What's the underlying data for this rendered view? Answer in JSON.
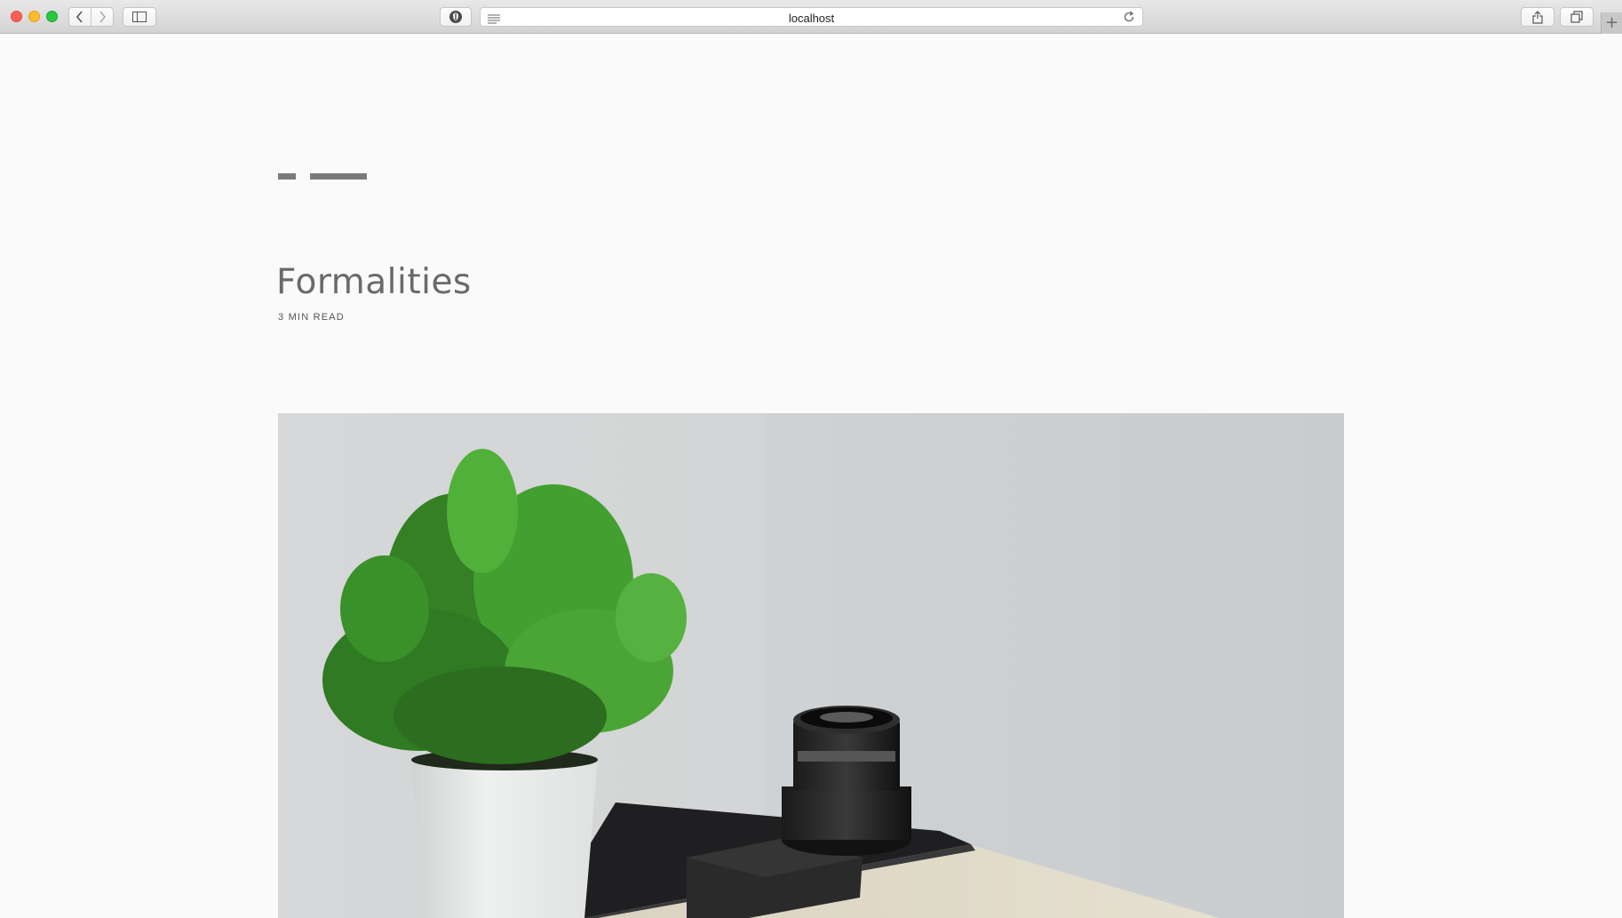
{
  "browser": {
    "address": "localhost",
    "buttons": {
      "back": "back-icon",
      "forward": "forward-icon",
      "sidebar": "sidebar-icon",
      "privacy": "shield-icon",
      "reader": "reader-icon",
      "reload": "reload-icon",
      "share": "share-icon",
      "tabs": "tabs-icon",
      "new_tab": "+"
    }
  },
  "post": {
    "title": "Formalities",
    "read_time": "3 MIN READ",
    "hero_image": "plant-and-camera-lens-photo"
  },
  "colors": {
    "background": "#fafafa",
    "logo": "#7a7a7a",
    "title": "#6a6a6a"
  }
}
